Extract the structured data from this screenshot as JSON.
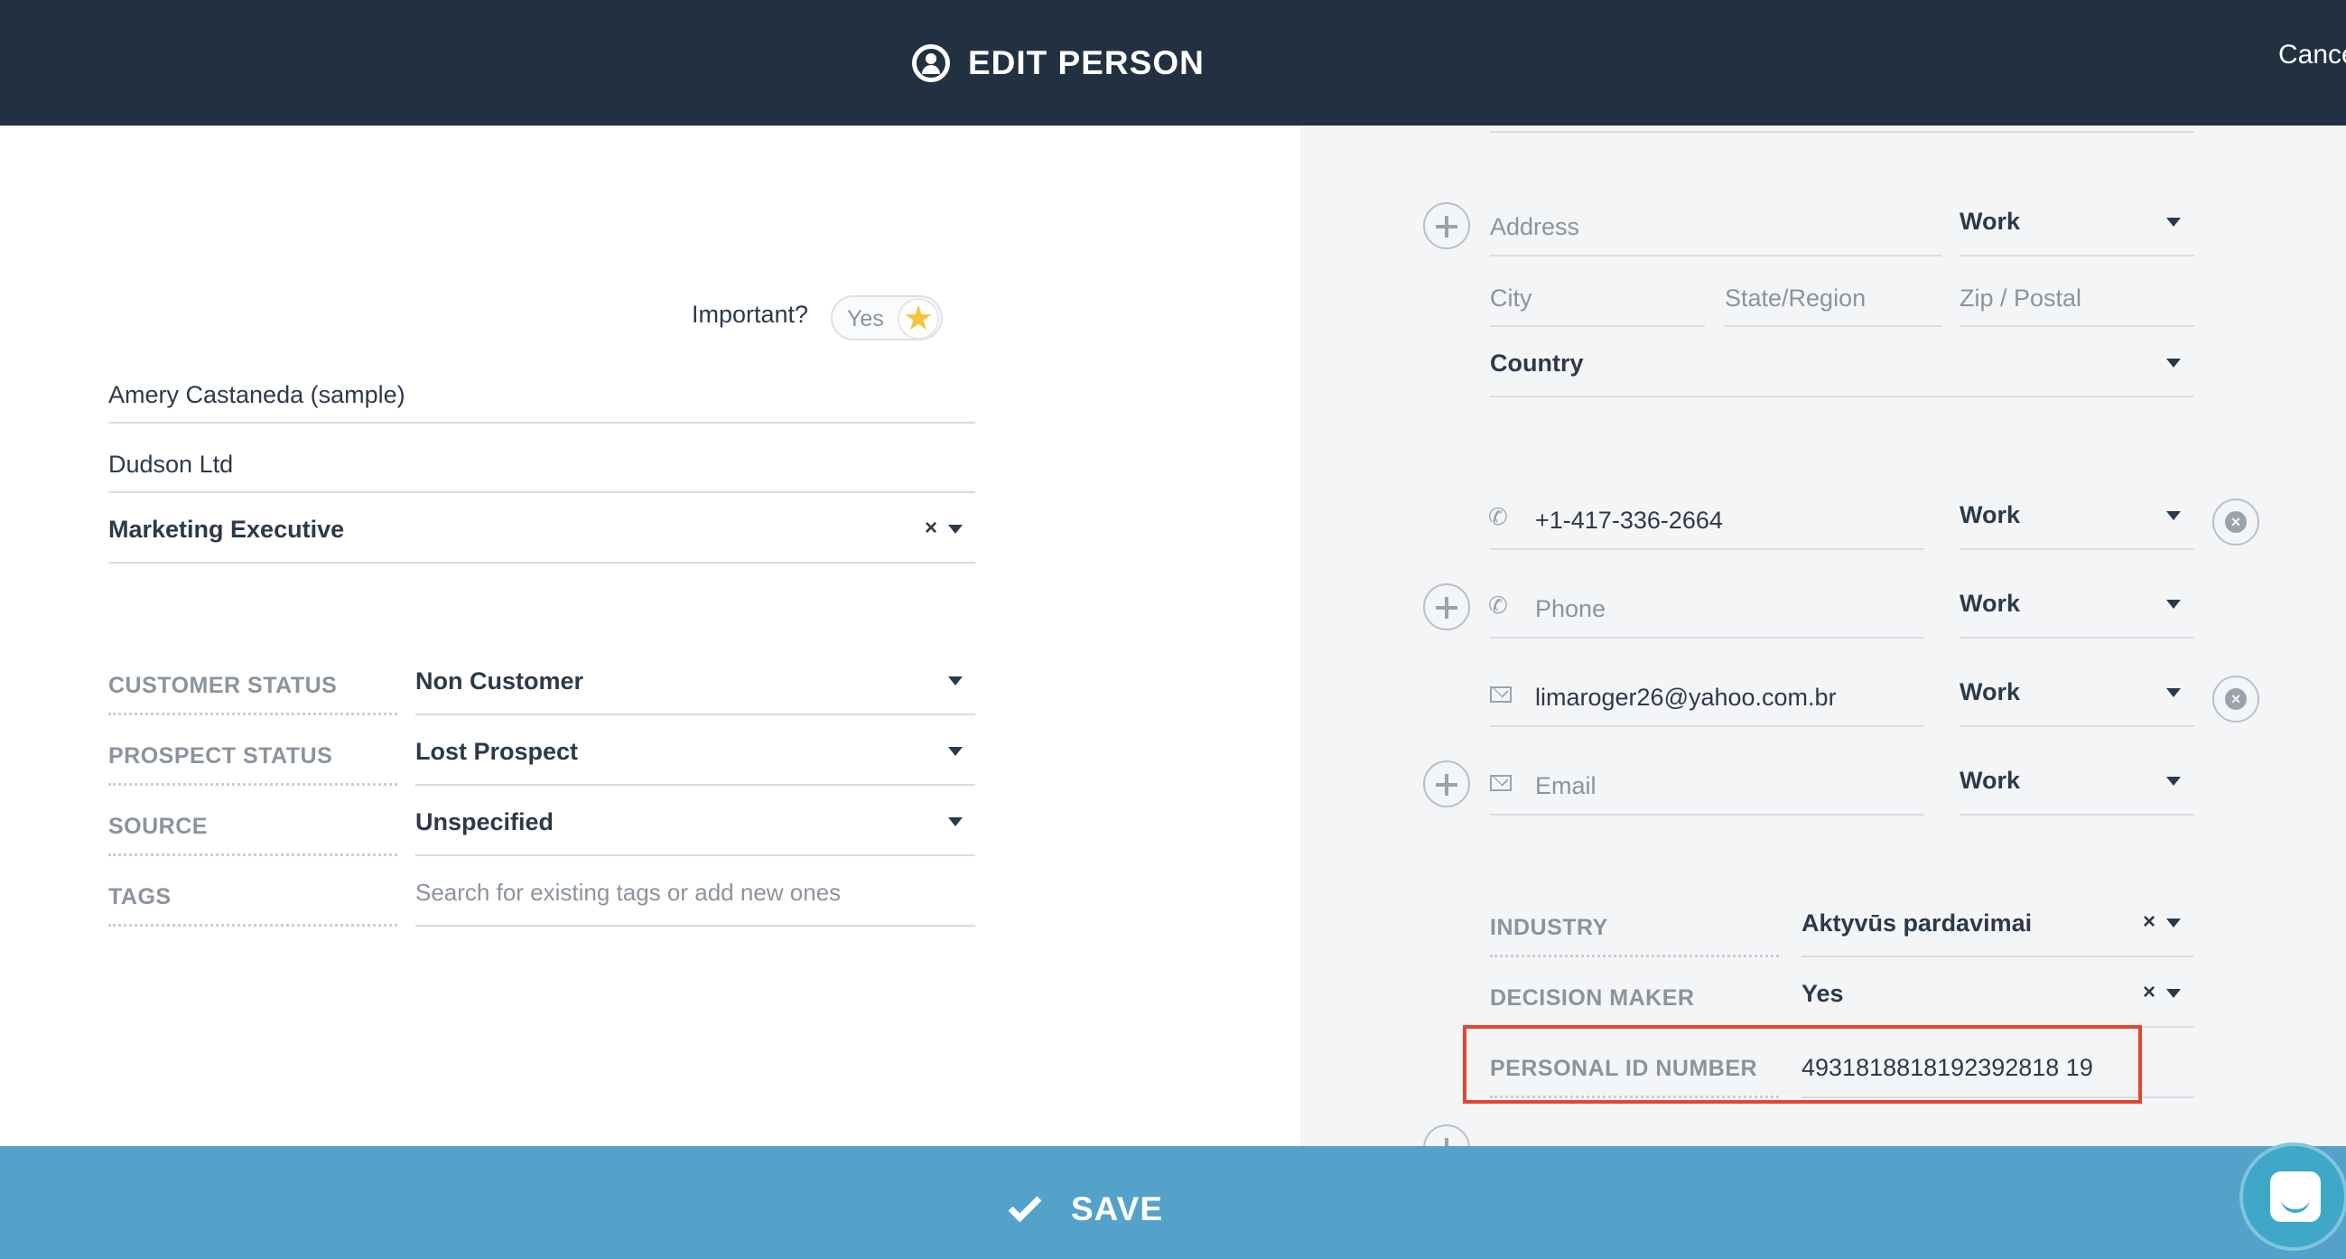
{
  "header": {
    "title": "EDIT PERSON",
    "cancel_label": "Cance"
  },
  "left": {
    "important_label": "Important?",
    "important_toggle": "Yes",
    "name": "Amery Castaneda (sample)",
    "company": "Dudson Ltd",
    "title": "Marketing Executive",
    "clear_symbol": "×",
    "fields": [
      {
        "label": "CUSTOMER STATUS",
        "value": "Non Customer"
      },
      {
        "label": "PROSPECT STATUS",
        "value": "Lost Prospect"
      },
      {
        "label": "SOURCE",
        "value": "Unspecified"
      },
      {
        "label": "TAGS",
        "placeholder": "Search for existing tags or add new ones"
      }
    ]
  },
  "right": {
    "address_placeholder": "Address",
    "address_type": "Work",
    "city_placeholder": "City",
    "state_placeholder": "State/Region",
    "zip_placeholder": "Zip / Postal",
    "country_label": "Country",
    "phone_value": "+1-417-336-2664",
    "phone_type": "Work",
    "phone_placeholder": "Phone",
    "phone_new_type": "Work",
    "email_value": "limaroger26@yahoo.com.br",
    "email_type": "Work",
    "email_placeholder": "Email",
    "email_new_type": "Work",
    "clear_symbol": "×",
    "custom_fields": [
      {
        "label": "INDUSTRY",
        "value": "Aktyvūs pardavimai"
      },
      {
        "label": "DECISION MAKER",
        "value": "Yes"
      },
      {
        "label": "PERSONAL ID NUMBER",
        "value": "4931818818192392818 19"
      }
    ]
  },
  "footer": {
    "save_label": "SAVE"
  },
  "colors": {
    "header_bg": "#223142",
    "footer_bg": "#54a1c9",
    "highlight": "#e3462f",
    "star": "#f6c43b"
  },
  "icons": [
    "person-icon",
    "star-icon",
    "caret-down-icon",
    "plus-circle-icon",
    "x-circle-icon",
    "phone-icon",
    "mail-icon",
    "check-icon",
    "chat-icon"
  ]
}
